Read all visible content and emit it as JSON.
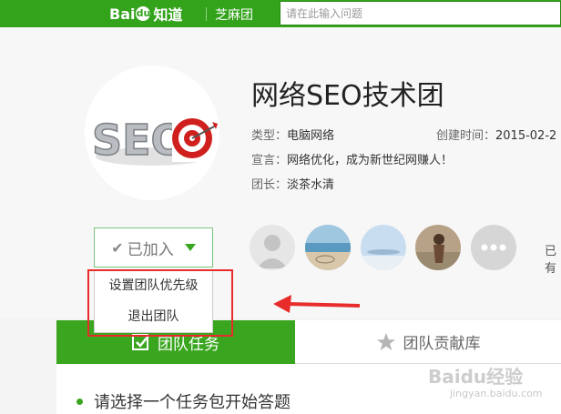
{
  "topbar": {
    "logo_text_left": "Bai",
    "logo_paw": "du",
    "logo_text_right": "知道",
    "team_nav": "芝麻团",
    "search_placeholder": "请在此输入问题"
  },
  "team": {
    "avatar_text": "SEO",
    "name": "网络SEO技术团",
    "type_label": "类型：",
    "type_value": "电脑网络",
    "created_label": "创建时间：",
    "created_value": "2015-02-2",
    "slogan_label": "宣言：",
    "slogan_value": "网络优化，成为新世纪网赚人！",
    "leader_label": "团长：",
    "leader_value": "淡茶水清"
  },
  "join_button": {
    "label": "已加入"
  },
  "dropdown": {
    "items": [
      {
        "label": "设置团队优先级"
      },
      {
        "label": "退出团队"
      }
    ]
  },
  "members": {
    "more_text": "已有"
  },
  "tabs": [
    {
      "label": "团队任务"
    },
    {
      "label": "团队贡献库"
    }
  ],
  "content": {
    "task_text": "请选择一个任务包开始答题"
  },
  "watermark": {
    "main": "Baidu经验",
    "sub": "jingyan.baidu.com"
  },
  "colors": {
    "brand_green": "#3aa61f",
    "highlight_red": "#e82c2c"
  }
}
